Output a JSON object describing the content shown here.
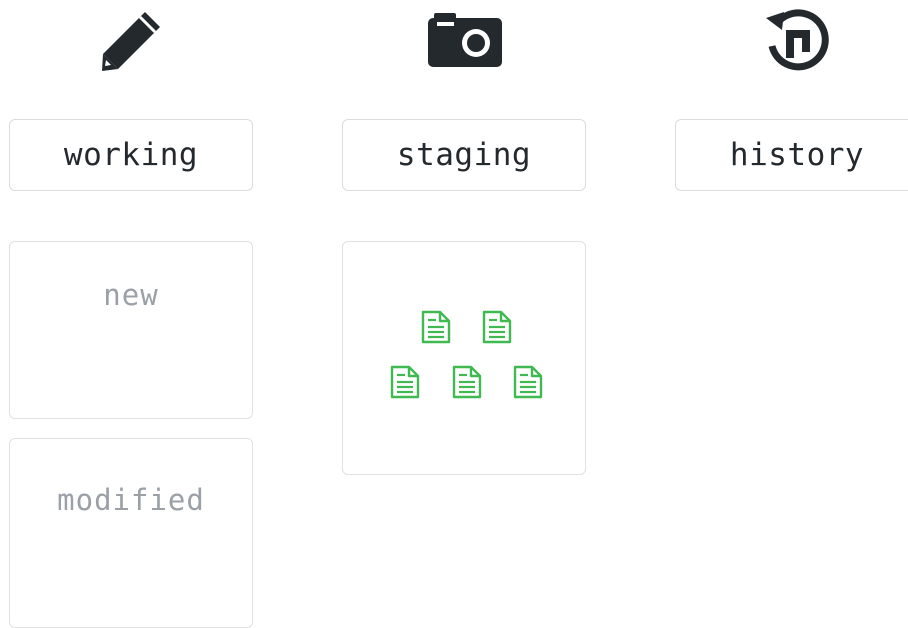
{
  "columns": [
    {
      "label": "working",
      "icon": "pencil-icon"
    },
    {
      "label": "staging",
      "icon": "camera-icon"
    },
    {
      "label": "history",
      "icon": "history-icon"
    }
  ],
  "working_areas": [
    {
      "title": "new"
    },
    {
      "title": "modified"
    }
  ],
  "staging_area": {
    "file_icon": "document-icon",
    "file_count": 5
  },
  "colors": {
    "icon": "#24292e",
    "label_text": "#24292e",
    "area_title": "#9aa0a6",
    "file_green": "#3fb950",
    "border": "#dcdcdc"
  }
}
